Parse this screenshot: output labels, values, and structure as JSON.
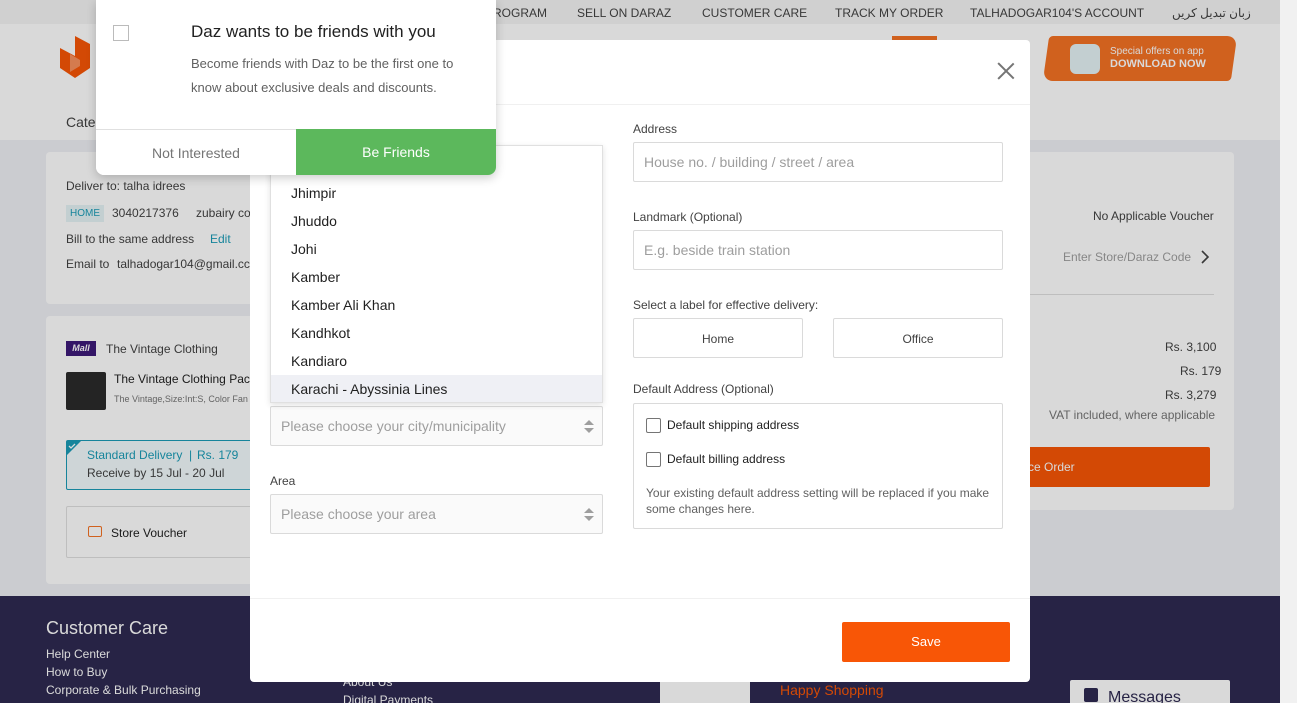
{
  "topbar": {
    "items": [
      "ROGRAM",
      "SELL ON DARAZ",
      "CUSTOMER CARE",
      "TRACK MY ORDER",
      "TALHADOGAR104'S ACCOUNT",
      "زبان تبدیل کریں"
    ]
  },
  "header": {
    "promo_line1": "Special offers on app",
    "promo_line2": "DOWNLOAD NOW",
    "category_label": "Cate"
  },
  "shipping_card": {
    "deliver_to": "Deliver to: talha idrees",
    "tag": "HOME",
    "phone": "3040217376",
    "address_snippet": "zubairy co",
    "bill_same": "Bill to the same address",
    "edit": "Edit",
    "email_label": "Email to",
    "email": "talhadogar104@gmail.cc"
  },
  "package_card": {
    "mall_badge": "Mall",
    "store": "The Vintage Clothing",
    "product_title": "The Vintage Clothing Pack",
    "product_variant": "The Vintage,Size:Int:S, Color Fan",
    "delivery_name": "Standard Delivery",
    "delivery_sep": "|",
    "delivery_price": "Rs. 179",
    "delivery_eta": "Receive by 15 Jul - 20 Jul",
    "store_voucher": "Store Voucher"
  },
  "summary_card": {
    "no_voucher": "No Applicable Voucher",
    "code_placeholder": "Enter Store/Daraz Code",
    "subtotal": "Rs. 3,100",
    "shipping": "Rs. 179",
    "total": "Rs. 3,279",
    "vat_note": "VAT included, where applicable",
    "place_order": "ce Order"
  },
  "footer": {
    "heading": "Customer Care",
    "links": [
      "Help Center",
      "How to Buy",
      "Corporate & Bulk Purchasing"
    ],
    "mid_links": [
      "About Us",
      "Digital Payments"
    ],
    "happy": "Happy Shopping",
    "messages": "Messages"
  },
  "modal": {
    "address_label": "Address",
    "address_placeholder": "House no. / building / street / area",
    "landmark_label": "Landmark (Optional)",
    "landmark_placeholder": "E.g. beside train station",
    "delivery_label_title": "Select a label for effective delivery:",
    "label_home": "Home",
    "label_office": "Office",
    "default_title": "Default Address (Optional)",
    "default_shipping": "Default shipping address",
    "default_billing": "Default billing address",
    "default_note": "Your existing default address setting will be replaced if you make some changes here.",
    "city_placeholder": "Please choose your city/municipality",
    "area_label": "Area",
    "area_placeholder": "Please choose your area",
    "save": "Save",
    "city_options": [
      "Jhimpir",
      "Jhuddo",
      "Johi",
      "Kamber",
      "Kamber Ali Khan",
      "Kandhkot",
      "Kandiaro",
      "Karachi - Abyssinia Lines"
    ]
  },
  "notification": {
    "title": "Daz wants to be friends with you",
    "body": "Become friends with Daz to be the first one to know about exclusive deals and discounts.",
    "decline": "Not Interested",
    "accept": "Be Friends"
  },
  "colors": {
    "brand_orange": "#f85606",
    "accent_teal": "#1a9cb7",
    "friends_green": "#5cb85c",
    "footer_bg": "#2e2a52"
  }
}
